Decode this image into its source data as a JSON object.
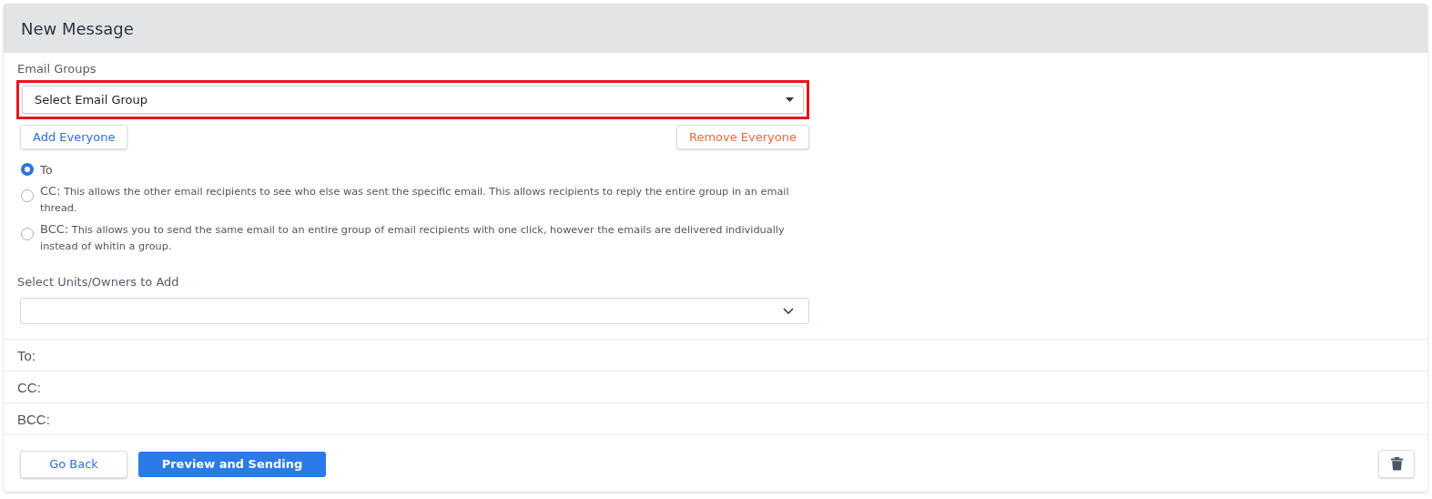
{
  "header": {
    "title": "New Message"
  },
  "email_groups": {
    "label": "Email Groups",
    "placeholder": "Select Email Group",
    "highlighted": true
  },
  "group_buttons": [
    {
      "label": "Add Everyone",
      "kind": "add"
    },
    {
      "label": "Remove Everyone",
      "kind": "remove"
    }
  ],
  "send_options": [
    {
      "label": "To",
      "selected": true
    },
    {
      "label": "CC:",
      "description": "This allows the other email recipients to see who else was sent the specific email. This allows recipients to reply the entire group in an email thread.",
      "selected": false
    },
    {
      "label": "BCC:",
      "description": "This allows you to send the same email to an entire group of email recipients with one click, however the emails are delivered individually instead of whitin a group.",
      "selected": false
    }
  ],
  "units_select": {
    "label": "Select Units/Owners to Add"
  },
  "recipients": [
    {
      "label": "To:"
    },
    {
      "label": "CC:"
    },
    {
      "label": "BCC:"
    }
  ],
  "footer": {
    "back": "Go Back",
    "send": "Preview and Sending"
  }
}
